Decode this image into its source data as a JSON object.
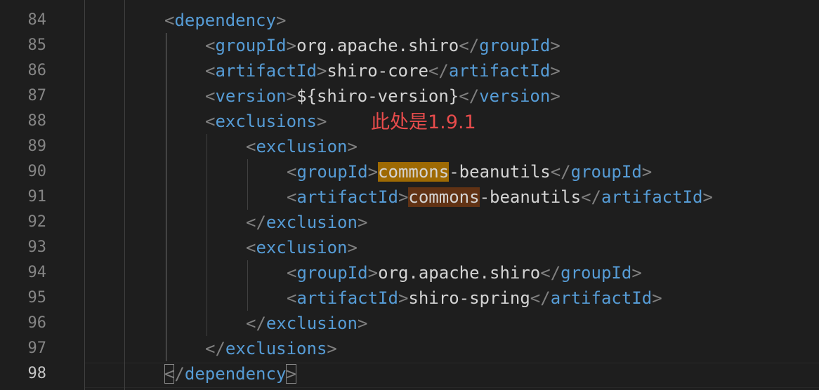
{
  "editor": {
    "annotation": "此处是1.9.1",
    "active_line": "98",
    "lines": [
      {
        "num": "84",
        "indent": 1,
        "kind": "open",
        "tag": "dependency"
      },
      {
        "num": "85",
        "indent": 2,
        "kind": "element",
        "tag": "groupId",
        "text": "org.apache.shiro"
      },
      {
        "num": "86",
        "indent": 2,
        "kind": "element",
        "tag": "artifactId",
        "text": "shiro-core"
      },
      {
        "num": "87",
        "indent": 2,
        "kind": "element",
        "tag": "version",
        "text": "${shiro-version}"
      },
      {
        "num": "88",
        "indent": 2,
        "kind": "open",
        "tag": "exclusions"
      },
      {
        "num": "89",
        "indent": 3,
        "kind": "open",
        "tag": "exclusion"
      },
      {
        "num": "90",
        "indent": 4,
        "kind": "element",
        "tag": "groupId",
        "text_highlight": "commons",
        "highlight_type": "find",
        "text": "-beanutils"
      },
      {
        "num": "91",
        "indent": 4,
        "kind": "element",
        "tag": "artifactId",
        "text_highlight": "commons",
        "highlight_type": "selection",
        "text": "-beanutils"
      },
      {
        "num": "92",
        "indent": 3,
        "kind": "close",
        "tag": "exclusion"
      },
      {
        "num": "93",
        "indent": 3,
        "kind": "open",
        "tag": "exclusion"
      },
      {
        "num": "94",
        "indent": 4,
        "kind": "element",
        "tag": "groupId",
        "text": "org.apache.shiro"
      },
      {
        "num": "95",
        "indent": 4,
        "kind": "element",
        "tag": "artifactId",
        "text": "shiro-spring"
      },
      {
        "num": "96",
        "indent": 3,
        "kind": "close",
        "tag": "exclusion"
      },
      {
        "num": "97",
        "indent": 2,
        "kind": "close",
        "tag": "exclusions"
      },
      {
        "num": "98",
        "indent": 1,
        "kind": "close",
        "tag": "dependency",
        "bracket_match": true
      }
    ]
  },
  "colors": {
    "background": "#1e1e1e",
    "tag": "#569cd6",
    "bracket": "#808080",
    "text": "#d4d4d4",
    "line_number": "#858585",
    "find_highlight": "#9e6a03",
    "selection_highlight": "#613214",
    "annotation": "#e84c4c"
  }
}
